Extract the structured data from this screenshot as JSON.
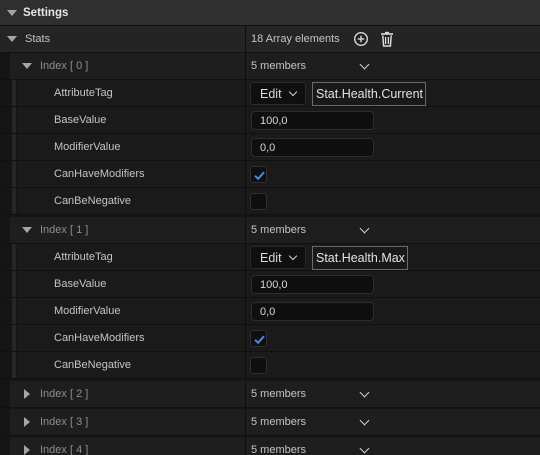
{
  "header": {
    "title": "Settings"
  },
  "stats": {
    "label": "Stats",
    "summary": "18 Array elements"
  },
  "elements": [
    {
      "index_label": "Index [ 0 ]",
      "members": "5 members",
      "fields": {
        "attribute_tag_label": "AttributeTag",
        "edit_label": "Edit",
        "attribute_tag_value": "Stat.Health.Current",
        "base_value_label": "BaseValue",
        "base_value": "100,0",
        "modifier_value_label": "ModifierValue",
        "modifier_value": "0,0",
        "can_have_modifiers_label": "CanHaveModifiers",
        "can_have_modifiers": true,
        "can_be_negative_label": "CanBeNegative",
        "can_be_negative": false
      }
    },
    {
      "index_label": "Index [ 1 ]",
      "members": "5 members",
      "fields": {
        "attribute_tag_label": "AttributeTag",
        "edit_label": "Edit",
        "attribute_tag_value": "Stat.Health.Max",
        "base_value_label": "BaseValue",
        "base_value": "100,0",
        "modifier_value_label": "ModifierValue",
        "modifier_value": "0,0",
        "can_have_modifiers_label": "CanHaveModifiers",
        "can_have_modifiers": true,
        "can_be_negative_label": "CanBeNegative",
        "can_be_negative": false
      }
    },
    {
      "index_label": "Index [ 2 ]",
      "members": "5 members"
    },
    {
      "index_label": "Index [ 3 ]",
      "members": "5 members"
    },
    {
      "index_label": "Index [ 4 ]",
      "members": "5 members"
    }
  ],
  "icons": {
    "add": "add-circle-icon",
    "delete": "trash-icon",
    "expanded": "triangle-down-icon",
    "collapsed": "triangle-right-icon",
    "dropdown": "chevron-down-icon",
    "check": "checkmark-icon"
  },
  "colors": {
    "checkmark": "#3d8fe6"
  }
}
